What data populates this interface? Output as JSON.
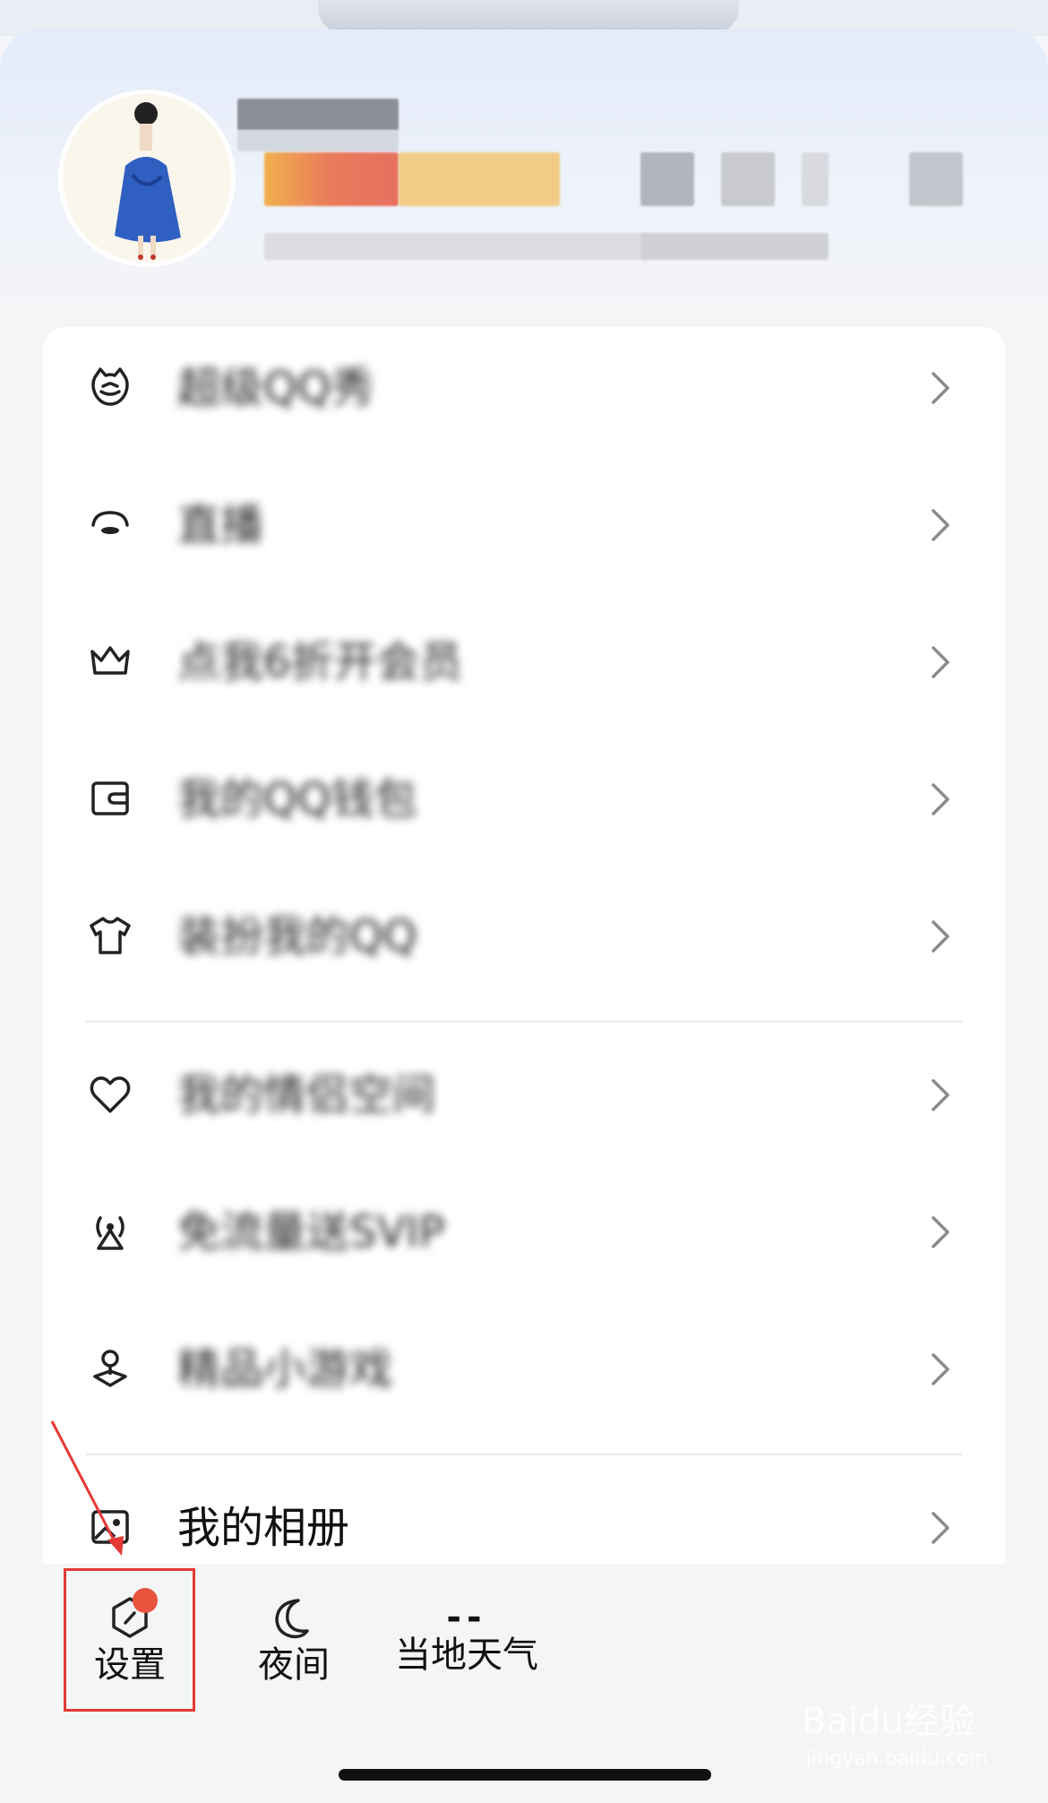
{
  "menu": {
    "items": [
      {
        "label": "超级QQ秀",
        "icon": "cat-icon",
        "blurred": true
      },
      {
        "label": "直播",
        "icon": "mask-icon",
        "blurred": true
      },
      {
        "label": "点我6折开会员",
        "icon": "crown-icon",
        "blurred": true
      },
      {
        "label": "我的QQ钱包",
        "icon": "wallet-icon",
        "blurred": true
      },
      {
        "label": "装扮我的QQ",
        "icon": "tshirt-icon",
        "blurred": true
      },
      {
        "label": "我的情侣空间",
        "icon": "heart-icon",
        "blurred": true
      },
      {
        "label": "免流量送SVIP",
        "icon": "signal-tower-icon",
        "blurred": true
      },
      {
        "label": "精品小游戏",
        "icon": "game-pin-icon",
        "blurred": true
      },
      {
        "label": "我的相册",
        "icon": "album-icon",
        "blurred": false
      }
    ]
  },
  "bottom": {
    "settings_label": "设置",
    "night_label": "夜间",
    "weather_value": "--",
    "weather_label": "当地天气"
  },
  "watermark": {
    "brand": "Baidu经验",
    "url": "jingyan.baidu.com"
  },
  "colors": {
    "badge": "#e8533d",
    "annotation": "#e53935",
    "header_bg": "#e3ebfa"
  }
}
